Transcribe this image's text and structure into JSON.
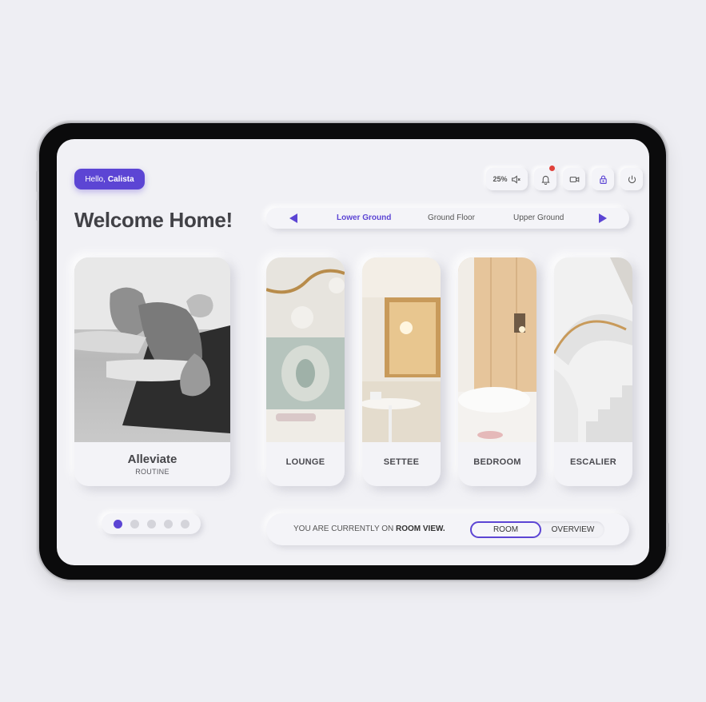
{
  "greeting": {
    "prefix": "Hello,",
    "name": "Calista"
  },
  "title": "Welcome Home!",
  "controls": {
    "volume_label": "25%",
    "icons": [
      "speaker-icon",
      "bell-icon",
      "video-camera-icon",
      "lock-icon",
      "power-icon"
    ]
  },
  "floors": {
    "items": [
      "Lower Ground",
      "Ground Floor",
      "Upper Ground"
    ],
    "active": "Lower Ground"
  },
  "routine": {
    "title": "Alleviate",
    "subtitle": "ROUTINE"
  },
  "rooms": [
    {
      "label": "LOUNGE"
    },
    {
      "label": "SETTEE"
    },
    {
      "label": "BEDROOM"
    },
    {
      "label": "ESCALIER"
    }
  ],
  "carousel": {
    "count": 5,
    "active_index": 0
  },
  "status": {
    "prefix": "YOU ARE CURRENTLY ON",
    "view": "ROOM VIEW.",
    "toggle": [
      "ROOM",
      "OVERVIEW"
    ],
    "selected": "ROOM"
  },
  "colors": {
    "accent": "#5c45d4",
    "notification": "#e0413a",
    "background": "#f1f1f5"
  }
}
